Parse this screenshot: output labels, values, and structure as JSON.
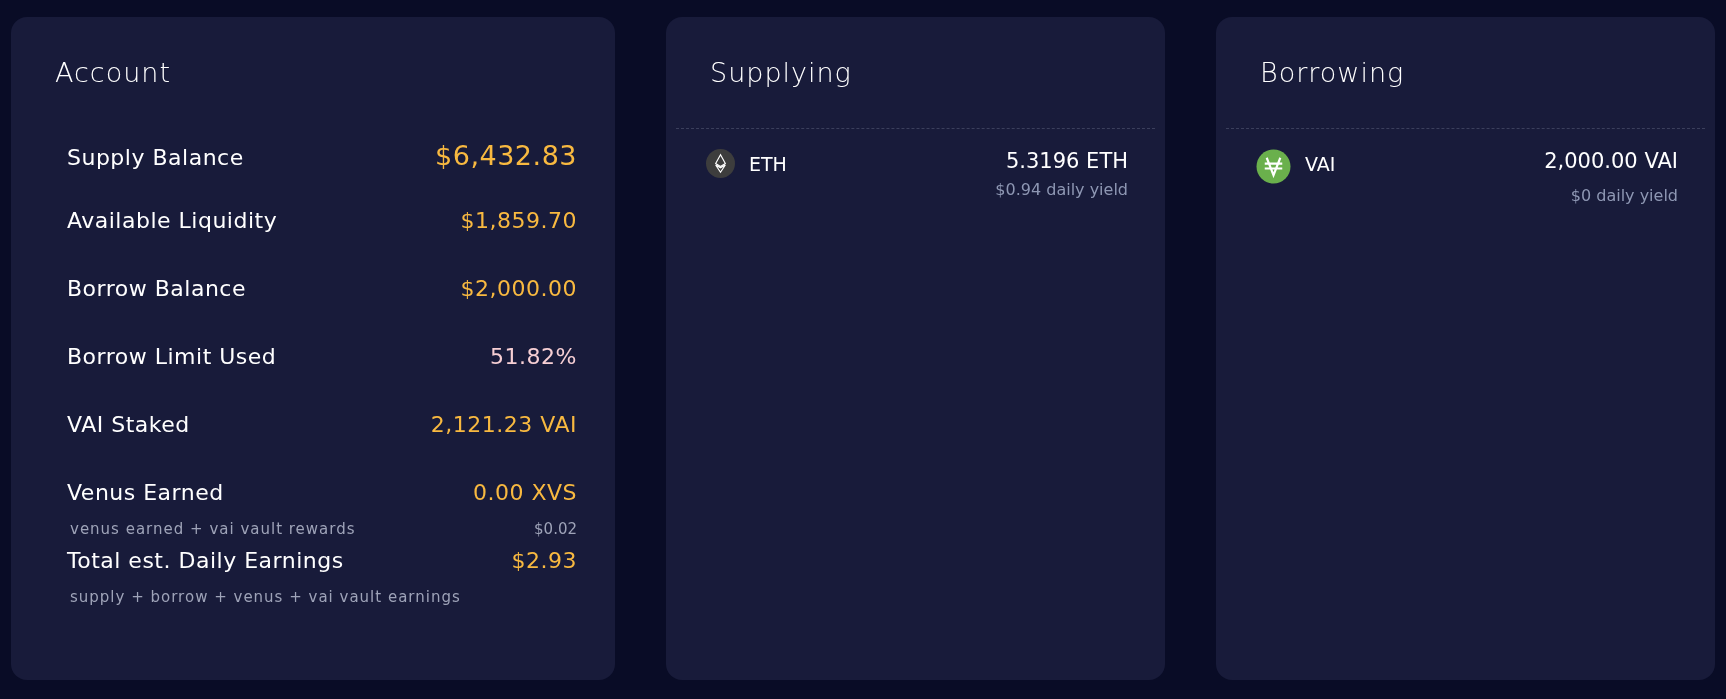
{
  "account": {
    "title": "Account",
    "rows": [
      {
        "label": "Supply Balance",
        "value": "$6,432.83",
        "kind": "primary"
      },
      {
        "label": "Available Liquidity",
        "value": "$1,859.70",
        "kind": "amount"
      },
      {
        "label": "Borrow Balance",
        "value": "$2,000.00",
        "kind": "amount"
      },
      {
        "label": "Borrow Limit Used",
        "value": "51.82%",
        "kind": "percent"
      },
      {
        "label": "VAI Staked",
        "value": "2,121.23 VAI",
        "kind": "amount"
      },
      {
        "label": "Venus Earned",
        "value": "0.00 XVS",
        "kind": "amount",
        "note": "venus earned + vai vault rewards",
        "subvalue": "$0.02"
      },
      {
        "label": "Total est. Daily Earnings",
        "value": "$2.93",
        "kind": "amount",
        "note": "supply + borrow + venus + vai vault earnings"
      }
    ]
  },
  "panels": [
    {
      "title": "Supplying",
      "assets": [
        {
          "symbol": "ETH",
          "kind": "eth",
          "amount": "5.3196 ETH",
          "yield": "$0.94 daily yield"
        }
      ]
    },
    {
      "title": "Borrowing",
      "assets": [
        {
          "symbol": "VAI",
          "kind": "vai",
          "amount": "2,000.00 VAI",
          "yield": "$0 daily yield"
        }
      ]
    }
  ]
}
